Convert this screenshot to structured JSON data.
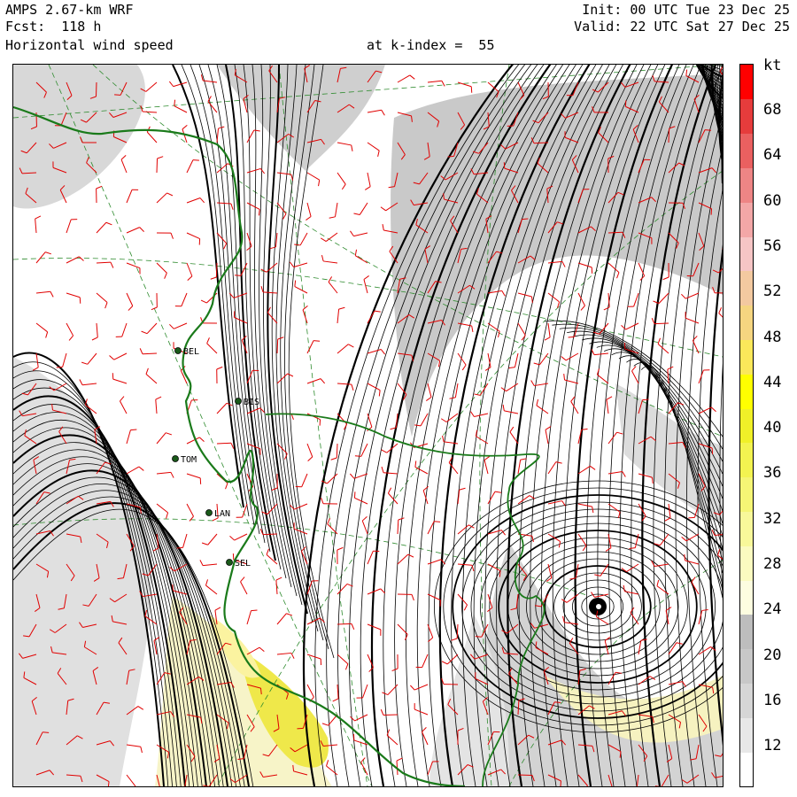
{
  "header": {
    "model": "AMPS 2.67-km WRF",
    "forecast": "Fcst:  118 h",
    "field": "Horizontal wind speed",
    "level": "at k-index =  55",
    "init": "Init: 00 UTC Tue 23 Dec 25",
    "valid": "Valid: 22 UTC Sat 27 Dec 25"
  },
  "colorbar": {
    "unit": "kt",
    "tick_labels": [
      "68",
      "64",
      "60",
      "56",
      "52",
      "48",
      "44",
      "40",
      "36",
      "32",
      "28",
      "24",
      "20",
      "16",
      "12"
    ],
    "colors": [
      "#ffffff",
      "#e8e8e8",
      "#d6d6d6",
      "#c8c8c8",
      "#bdbdbd",
      "#fdfde0",
      "#fbfbc0",
      "#f8f89a",
      "#f5f575",
      "#f3f350",
      "#f0f028",
      "#ffff00",
      "#fbe85a",
      "#f5d580",
      "#f3c9a0",
      "#f6c5c5",
      "#f3a7a7",
      "#ee8585",
      "#ea6060",
      "#e63c3c",
      "#ff0000"
    ]
  },
  "map": {
    "stations": [
      "BIS",
      "TOM",
      "LAN",
      "SEL",
      "BEL"
    ],
    "colors": {
      "coast": "#1a7a1a",
      "barbs": "#e00000",
      "streamlines": "#000000",
      "grid": "#2e8b2e"
    }
  }
}
